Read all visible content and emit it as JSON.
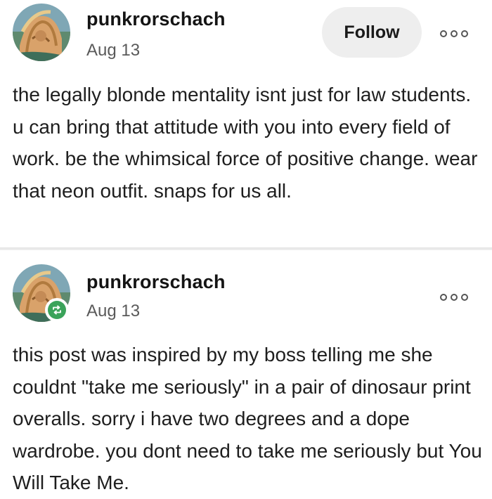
{
  "posts": [
    {
      "username": "punkrorschach",
      "date": "Aug 13",
      "follow_label": "Follow",
      "body": "the legally blonde mentality isnt just for law students. u can bring that attitude with you into every field of work. be the whimsical force of positive change. wear that neon outfit. snaps for us all."
    },
    {
      "username": "punkrorschach",
      "date": "Aug 13",
      "reblog_icon": "reblog-icon",
      "body": "this post was inspired by my boss telling me she couldnt \"take me seriously\" in a pair of dinosaur print overalls. sorry i have two degrees and a dope wardrobe. you dont need to take me seriously but You Will Take Me."
    }
  ],
  "colors": {
    "reblog_badge": "#3aa35a",
    "follow_button_bg": "#eeeeee",
    "divider": "#e4e4e4"
  }
}
